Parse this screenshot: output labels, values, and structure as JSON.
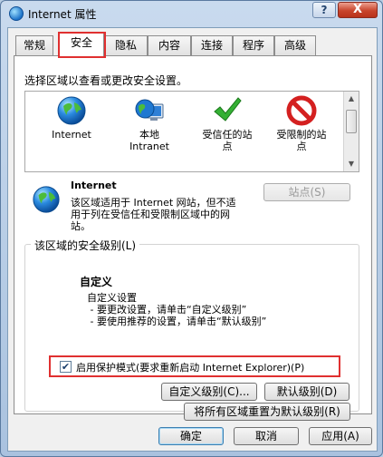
{
  "window": {
    "title": "Internet 属性",
    "help_glyph": "?",
    "close_glyph": "X"
  },
  "tabs": [
    {
      "label": "常规"
    },
    {
      "label": "安全",
      "active": true
    },
    {
      "label": "隐私"
    },
    {
      "label": "内容"
    },
    {
      "label": "连接"
    },
    {
      "label": "程序"
    },
    {
      "label": "高级"
    }
  ],
  "security": {
    "heading": "选择区域以查看或更改安全设置。",
    "zones": [
      {
        "label": "Internet",
        "icon": "globe-icon"
      },
      {
        "label": "本地\nIntranet",
        "icon": "intranet-icon"
      },
      {
        "label": "受信任的站\n点",
        "icon": "checkmark-icon"
      },
      {
        "label": "受限制的站\n点",
        "icon": "no-entry-icon"
      }
    ],
    "detail": {
      "title": "Internet",
      "description": "该区域适用于 Internet 网站，但不适用于列在受信任和受限制区域中的网站。",
      "sites_button": "站点(S)"
    },
    "level": {
      "caption": "该区域的安全级别(L)",
      "name": "自定义",
      "description": "自定义设置\n - 要更改设置，请单击“自定义级别”\n - 要使用推荐的设置，请单击“默认级别”",
      "protected_mode_label": "启用保护模式(要求重新启动 Internet Explorer)(P)",
      "protected_mode_checked": true,
      "custom_level_button": "自定义级别(C)...",
      "default_level_button": "默认级别(D)"
    },
    "reset_all_button": "将所有区域重置为默认级别(R)"
  },
  "footer": {
    "ok": "确定",
    "cancel": "取消",
    "apply": "应用(A)"
  },
  "colors": {
    "highlight": "#e03030",
    "globe": "#1c72c8",
    "check": "#2fa82f",
    "restricted": "#d42020"
  }
}
